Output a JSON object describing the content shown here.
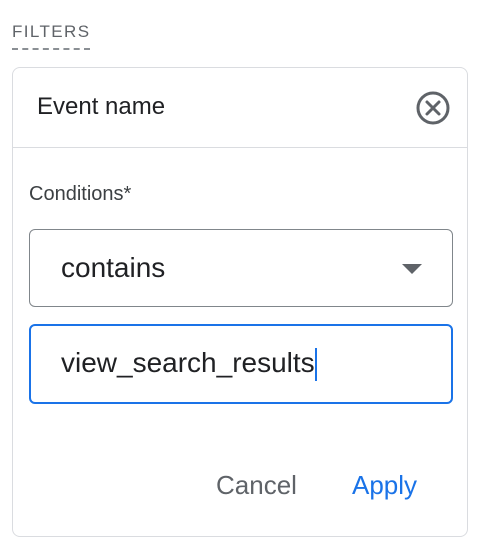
{
  "filters": {
    "heading": "FILTERS"
  },
  "filter_card": {
    "title": "Event name",
    "remove_icon": "close-circle-icon",
    "conditions_label": "Conditions*",
    "operator": {
      "selected": "contains",
      "icon": "dropdown-arrow-icon"
    },
    "value_input": {
      "value": "view_search_results"
    },
    "actions": {
      "cancel_label": "Cancel",
      "apply_label": "Apply"
    }
  },
  "colors": {
    "accent": "#1a73e8",
    "border": "#dadce0",
    "text": "#202124",
    "muted": "#5f6368"
  }
}
